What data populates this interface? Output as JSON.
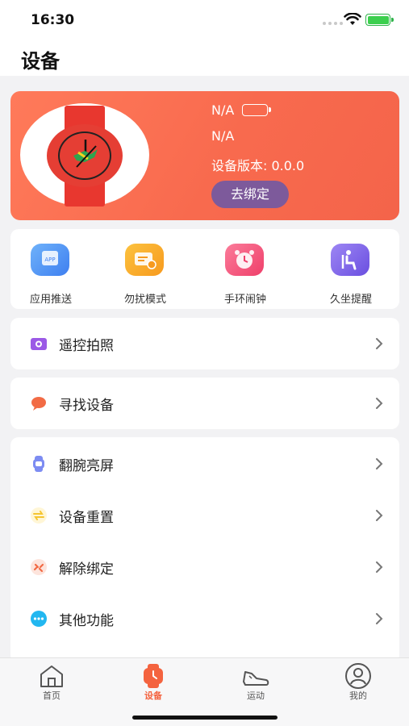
{
  "status_bar": {
    "time": "16:30"
  },
  "header": {
    "title": "设备"
  },
  "device": {
    "name": "N/A",
    "mac": "N/A",
    "version": "设备版本: 0.0.0",
    "unbind_label": "去绑定"
  },
  "quick_actions": [
    {
      "label": "应用推送",
      "icon": "app-push-icon",
      "color": "#4a8ff0"
    },
    {
      "label": "勿扰模式",
      "icon": "do-not-disturb-icon",
      "color": "#f9a72a"
    },
    {
      "label": "手环闹钟",
      "icon": "alarm-clock-icon",
      "color": "#f2507a"
    },
    {
      "label": "久坐提醒",
      "icon": "sedentary-reminder-icon",
      "color": "#7b63e8"
    }
  ],
  "menu": {
    "remote_camera": {
      "label": "遥控拍照",
      "icon": "camera-icon",
      "color": "#9b59e6"
    },
    "find_device": {
      "label": "寻找设备",
      "icon": "chat-bubble-icon",
      "color": "#f26b45"
    },
    "settings": [
      {
        "label": "翻腕亮屏",
        "icon": "watch-icon",
        "color": "#7d8cf2"
      },
      {
        "label": "设备重置",
        "icon": "reset-icon",
        "color": "#f5c531"
      },
      {
        "label": "解除绑定",
        "icon": "unlink-icon",
        "color": "#f26b45"
      },
      {
        "label": "其他功能",
        "icon": "more-icon",
        "color": "#22b7f0"
      }
    ]
  },
  "tab_bar": [
    {
      "label": "首页",
      "icon": "home-icon",
      "active": false
    },
    {
      "label": "设备",
      "icon": "device-icon",
      "active": true
    },
    {
      "label": "运动",
      "icon": "sneaker-icon",
      "active": false
    },
    {
      "label": "我的",
      "icon": "profile-icon",
      "active": false
    }
  ],
  "colors": {
    "accent": "#f4633f",
    "card_gradient": "#f86a4e",
    "unbind_button": "#7d5a9b",
    "background": "#f2f2f4"
  }
}
